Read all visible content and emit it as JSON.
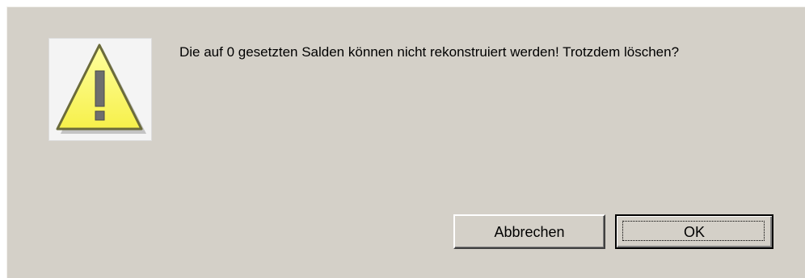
{
  "dialog": {
    "message": "Die auf 0 gesetzten Salden können nicht rekonstruiert werden! Trotzdem löschen?",
    "icon": "warning-icon",
    "buttons": {
      "cancel_label": "Abbrechen",
      "ok_label": "OK"
    }
  },
  "colors": {
    "dialog_background": "#d4d0c8",
    "warning_fill": "#ffff66",
    "warning_outline": "#6b6b3a"
  }
}
